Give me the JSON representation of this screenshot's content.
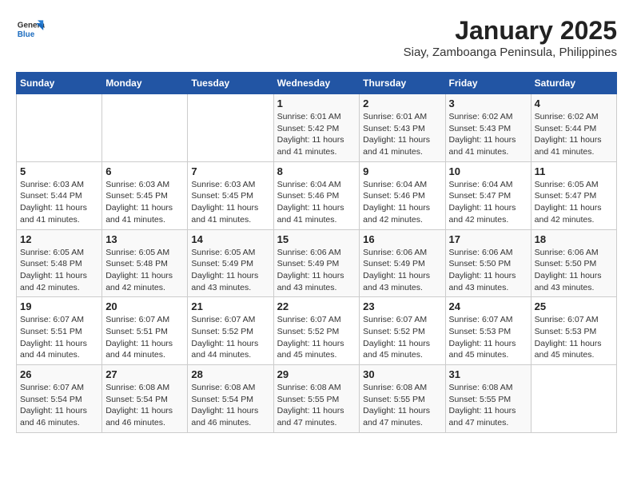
{
  "logo": {
    "general": "General",
    "blue": "Blue"
  },
  "title": "January 2025",
  "subtitle": "Siay, Zamboanga Peninsula, Philippines",
  "days_of_week": [
    "Sunday",
    "Monday",
    "Tuesday",
    "Wednesday",
    "Thursday",
    "Friday",
    "Saturday"
  ],
  "weeks": [
    [
      {
        "day": "",
        "info": ""
      },
      {
        "day": "",
        "info": ""
      },
      {
        "day": "",
        "info": ""
      },
      {
        "day": "1",
        "info": "Sunrise: 6:01 AM\nSunset: 5:42 PM\nDaylight: 11 hours and 41 minutes."
      },
      {
        "day": "2",
        "info": "Sunrise: 6:01 AM\nSunset: 5:43 PM\nDaylight: 11 hours and 41 minutes."
      },
      {
        "day": "3",
        "info": "Sunrise: 6:02 AM\nSunset: 5:43 PM\nDaylight: 11 hours and 41 minutes."
      },
      {
        "day": "4",
        "info": "Sunrise: 6:02 AM\nSunset: 5:44 PM\nDaylight: 11 hours and 41 minutes."
      }
    ],
    [
      {
        "day": "5",
        "info": "Sunrise: 6:03 AM\nSunset: 5:44 PM\nDaylight: 11 hours and 41 minutes."
      },
      {
        "day": "6",
        "info": "Sunrise: 6:03 AM\nSunset: 5:45 PM\nDaylight: 11 hours and 41 minutes."
      },
      {
        "day": "7",
        "info": "Sunrise: 6:03 AM\nSunset: 5:45 PM\nDaylight: 11 hours and 41 minutes."
      },
      {
        "day": "8",
        "info": "Sunrise: 6:04 AM\nSunset: 5:46 PM\nDaylight: 11 hours and 41 minutes."
      },
      {
        "day": "9",
        "info": "Sunrise: 6:04 AM\nSunset: 5:46 PM\nDaylight: 11 hours and 42 minutes."
      },
      {
        "day": "10",
        "info": "Sunrise: 6:04 AM\nSunset: 5:47 PM\nDaylight: 11 hours and 42 minutes."
      },
      {
        "day": "11",
        "info": "Sunrise: 6:05 AM\nSunset: 5:47 PM\nDaylight: 11 hours and 42 minutes."
      }
    ],
    [
      {
        "day": "12",
        "info": "Sunrise: 6:05 AM\nSunset: 5:48 PM\nDaylight: 11 hours and 42 minutes."
      },
      {
        "day": "13",
        "info": "Sunrise: 6:05 AM\nSunset: 5:48 PM\nDaylight: 11 hours and 42 minutes."
      },
      {
        "day": "14",
        "info": "Sunrise: 6:05 AM\nSunset: 5:49 PM\nDaylight: 11 hours and 43 minutes."
      },
      {
        "day": "15",
        "info": "Sunrise: 6:06 AM\nSunset: 5:49 PM\nDaylight: 11 hours and 43 minutes."
      },
      {
        "day": "16",
        "info": "Sunrise: 6:06 AM\nSunset: 5:49 PM\nDaylight: 11 hours and 43 minutes."
      },
      {
        "day": "17",
        "info": "Sunrise: 6:06 AM\nSunset: 5:50 PM\nDaylight: 11 hours and 43 minutes."
      },
      {
        "day": "18",
        "info": "Sunrise: 6:06 AM\nSunset: 5:50 PM\nDaylight: 11 hours and 43 minutes."
      }
    ],
    [
      {
        "day": "19",
        "info": "Sunrise: 6:07 AM\nSunset: 5:51 PM\nDaylight: 11 hours and 44 minutes."
      },
      {
        "day": "20",
        "info": "Sunrise: 6:07 AM\nSunset: 5:51 PM\nDaylight: 11 hours and 44 minutes."
      },
      {
        "day": "21",
        "info": "Sunrise: 6:07 AM\nSunset: 5:52 PM\nDaylight: 11 hours and 44 minutes."
      },
      {
        "day": "22",
        "info": "Sunrise: 6:07 AM\nSunset: 5:52 PM\nDaylight: 11 hours and 45 minutes."
      },
      {
        "day": "23",
        "info": "Sunrise: 6:07 AM\nSunset: 5:52 PM\nDaylight: 11 hours and 45 minutes."
      },
      {
        "day": "24",
        "info": "Sunrise: 6:07 AM\nSunset: 5:53 PM\nDaylight: 11 hours and 45 minutes."
      },
      {
        "day": "25",
        "info": "Sunrise: 6:07 AM\nSunset: 5:53 PM\nDaylight: 11 hours and 45 minutes."
      }
    ],
    [
      {
        "day": "26",
        "info": "Sunrise: 6:07 AM\nSunset: 5:54 PM\nDaylight: 11 hours and 46 minutes."
      },
      {
        "day": "27",
        "info": "Sunrise: 6:08 AM\nSunset: 5:54 PM\nDaylight: 11 hours and 46 minutes."
      },
      {
        "day": "28",
        "info": "Sunrise: 6:08 AM\nSunset: 5:54 PM\nDaylight: 11 hours and 46 minutes."
      },
      {
        "day": "29",
        "info": "Sunrise: 6:08 AM\nSunset: 5:55 PM\nDaylight: 11 hours and 47 minutes."
      },
      {
        "day": "30",
        "info": "Sunrise: 6:08 AM\nSunset: 5:55 PM\nDaylight: 11 hours and 47 minutes."
      },
      {
        "day": "31",
        "info": "Sunrise: 6:08 AM\nSunset: 5:55 PM\nDaylight: 11 hours and 47 minutes."
      },
      {
        "day": "",
        "info": ""
      }
    ]
  ]
}
